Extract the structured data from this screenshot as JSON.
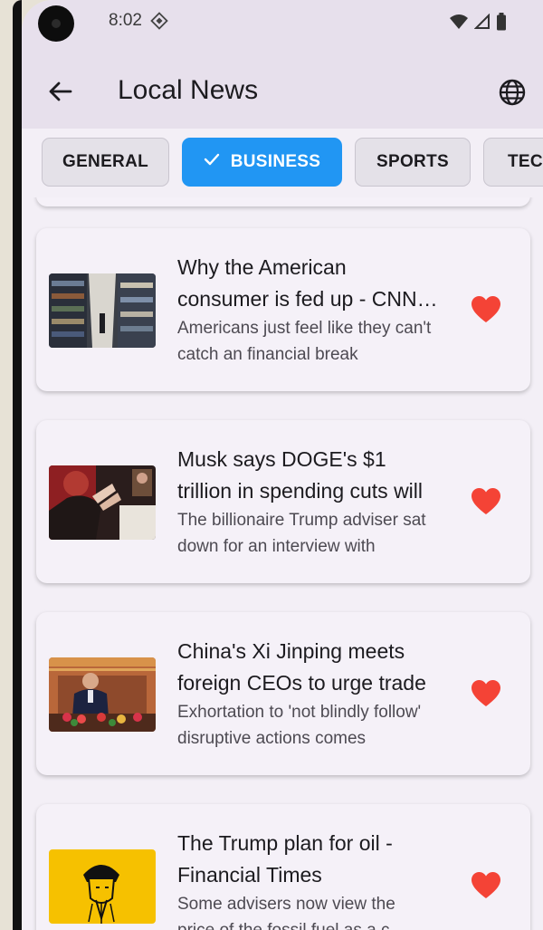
{
  "status_bar": {
    "time": "8:02"
  },
  "app_bar": {
    "title": "Local News",
    "back_icon": "arrow-back-icon",
    "language_icon": "globe-icon"
  },
  "categories": [
    {
      "label": "GENERAL",
      "selected": false
    },
    {
      "label": "BUSINESS",
      "selected": true
    },
    {
      "label": "SPORTS",
      "selected": false
    },
    {
      "label": "TECHNOLOGY",
      "selected": false
    }
  ],
  "articles": [
    {
      "title": "Why the American consumer is fed up - CNN Business",
      "description": "Americans just feel like they can't catch an financial break",
      "image_icon": "grocery-aisle-thumbnail",
      "favorite": true
    },
    {
      "title": "Musk says DOGE's $1 trillion in spending cuts will",
      "description": "The billionaire Trump adviser sat down for an interview with",
      "image_icon": "interview-thumbnail",
      "favorite": true
    },
    {
      "title": "China's Xi Jinping meets foreign CEOs to urge trade",
      "description": "Exhortation to 'not blindly follow' disruptive actions comes",
      "image_icon": "meeting-thumbnail",
      "favorite": true
    },
    {
      "title": "The Trump plan for oil - Financial Times",
      "description": "Some advisers now view the price of the fossil fuel as a c",
      "image_icon": "illustration-thumbnail",
      "favorite": true
    }
  ],
  "colors": {
    "accent": "#2196f3",
    "favorite": "#f44336",
    "app_bar": "#e7e0ec",
    "background": "#f3eff6"
  }
}
